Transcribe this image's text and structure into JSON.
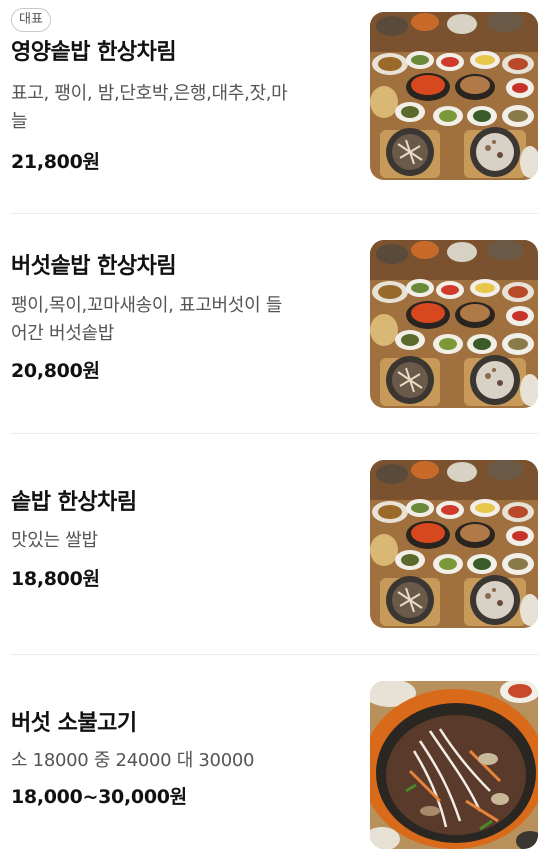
{
  "menu": {
    "badge": "대표",
    "items": [
      {
        "name": "영양솥밥 한상차림",
        "description": "표고, 팽이, 밤,단호박,은행,대추,잣,마\n늘",
        "price": "21,800원",
        "photo": "hansang-table-photo"
      },
      {
        "name": "버섯솥밥 한상차림",
        "description": "팽이,목이,꼬마새송이, 표고버섯이 들\n어간 버섯솥밥",
        "price": "20,800원",
        "photo": "hansang-table-photo"
      },
      {
        "name": "솥밥 한상차림",
        "description": "맛있는 쌀밥",
        "price": "18,800원",
        "photo": "hansang-table-photo"
      },
      {
        "name": "버섯 소불고기",
        "description": "소 18000 중 24000 대 30000",
        "price": "18,000~30,000원",
        "photo": "bulgogi-pan-photo"
      }
    ]
  }
}
